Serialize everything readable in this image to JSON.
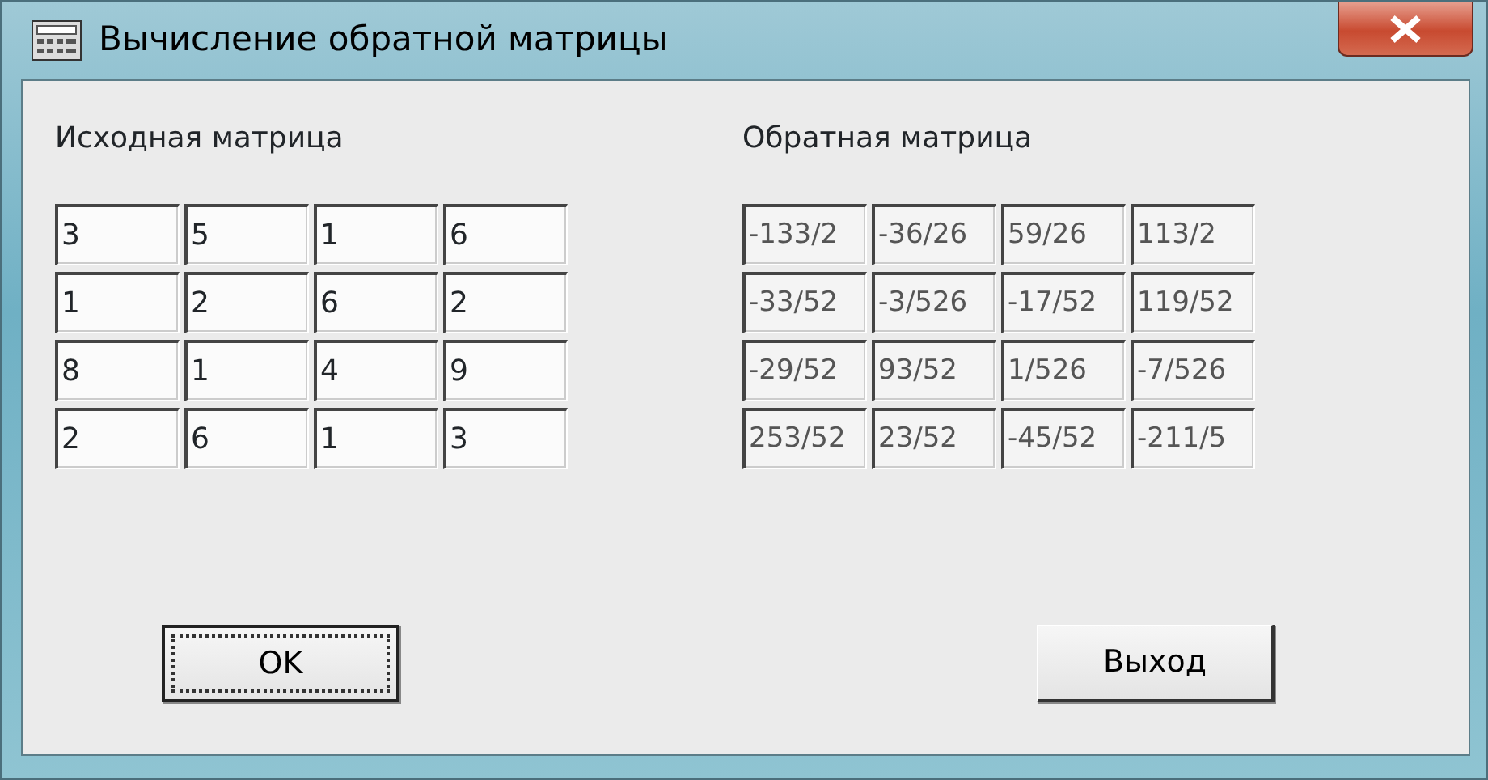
{
  "window": {
    "title": "Вычисление обратной матрицы"
  },
  "source_matrix": {
    "label": "Исходная матрица",
    "readonly": false,
    "rows": [
      [
        "3",
        "5",
        "1",
        "6"
      ],
      [
        "1",
        "2",
        "6",
        "2"
      ],
      [
        "8",
        "1",
        "4",
        "9"
      ],
      [
        "2",
        "6",
        "1",
        "3"
      ]
    ]
  },
  "inverse_matrix": {
    "label": "Обратная матрица",
    "readonly": true,
    "rows": [
      [
        "-133/2",
        "-36/26",
        "59/26",
        "113/2"
      ],
      [
        "-33/52",
        "-3/526",
        "-17/52",
        "119/52"
      ],
      [
        "-29/52",
        "93/52",
        "1/526",
        "-7/526"
      ],
      [
        "253/52",
        "23/52",
        "-45/52",
        "-211/5"
      ]
    ]
  },
  "buttons": [
    {
      "label": "OK",
      "default": true
    },
    {
      "label": "Выход",
      "default": false
    }
  ]
}
